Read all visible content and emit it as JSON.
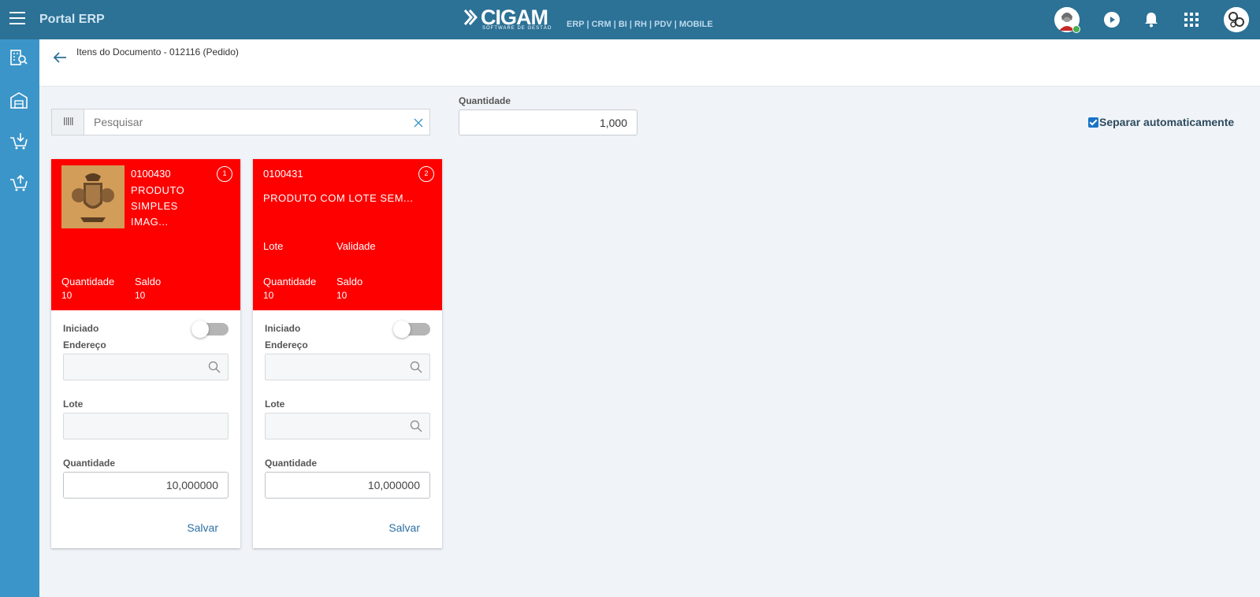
{
  "topbar": {
    "app_title": "Portal ERP",
    "logo_text": "CIGAM",
    "logo_subtext": "SOFTWARE DE GESTÃO",
    "modules": "ERP | CRM | BI | RH | PDV | MOBILE",
    "icons": [
      "hamburger-menu-icon",
      "user-avatar",
      "play-icon",
      "bell-icon",
      "apps-grid-icon",
      "company-avatar"
    ],
    "color": "#2c7196"
  },
  "sidebar": {
    "color": "#3b95c8",
    "items": [
      "building-search-icon",
      "warehouse-icon",
      "cart-download-icon",
      "cart-upload-icon"
    ]
  },
  "header": {
    "breadcrumb": "Itens do Documento - 012116 (Pedido)"
  },
  "search": {
    "placeholder": "Pesquisar",
    "value": ""
  },
  "quantity": {
    "label": "Quantidade",
    "value": "1,000"
  },
  "auto_separate": {
    "label": "Separar automaticamente",
    "checked": true
  },
  "cards": [
    {
      "badge": "1",
      "code": "0100430",
      "description": "PRODUTO SIMPLES IMAG...",
      "has_image": true,
      "quantity_label": "Quantidade",
      "quantity": "10",
      "balance_label": "Saldo",
      "balance": "10",
      "started_label": "Iniciado",
      "started": false,
      "address_label": "Endereço",
      "address": "",
      "lot_label": "Lote",
      "lot": "",
      "qty_label": "Quantidade",
      "qty": "10,000000",
      "save_label": "Salvar"
    },
    {
      "badge": "2",
      "code": "0100431",
      "description": "PRODUTO COM LOTE SEM...",
      "has_image": false,
      "lot_header_label": "Lote",
      "validity_label": "Validade",
      "quantity_label": "Quantidade",
      "quantity": "10",
      "balance_label": "Saldo",
      "balance": "10",
      "started_label": "Iniciado",
      "started": false,
      "address_label": "Endereço",
      "address": "",
      "lot_label": "Lote",
      "lot": "",
      "qty_label": "Quantidade",
      "qty": "10,000000",
      "save_label": "Salvar"
    }
  ],
  "colors": {
    "card_header": "#ff0000",
    "link": "#2c6fa3",
    "background": "#f0f4f8"
  }
}
